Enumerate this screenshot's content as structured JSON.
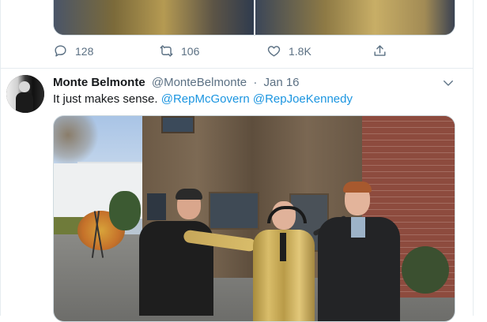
{
  "previous_tweet": {
    "actions": {
      "replies": "128",
      "retweets": "106",
      "likes": "1.8K"
    }
  },
  "tweet": {
    "author_name": "Monte Belmonte",
    "author_handle": "@MonteBelmonte",
    "separator": "·",
    "date": "Jan 16",
    "text": "It just makes sense.",
    "mentions": [
      "@RepMcGovern",
      "@RepJoeKennedy"
    ]
  },
  "icons": {
    "reply": "reply-icon",
    "retweet": "retweet-icon",
    "like": "heart-icon",
    "share": "share-icon",
    "more": "chevron-down-icon"
  },
  "colors": {
    "link": "#1b95e0",
    "secondary_text": "#5b7083",
    "border": "#e6ecf0"
  }
}
